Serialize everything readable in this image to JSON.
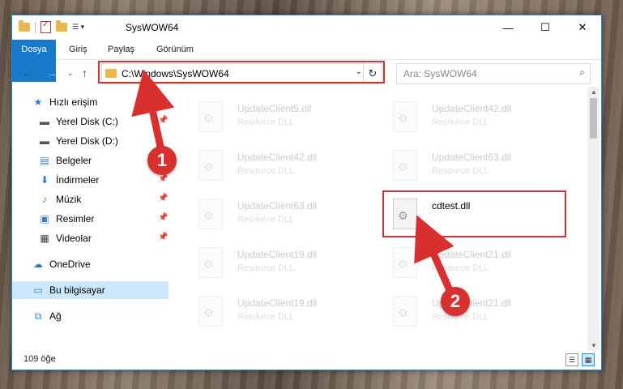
{
  "window": {
    "title": "SysWOW64",
    "controls": {
      "minimize": "—",
      "maximize": "☐",
      "close": "✕"
    }
  },
  "ribbon": {
    "tabs": [
      "Dosya",
      "Giriş",
      "Paylaş",
      "Görünüm"
    ]
  },
  "address": {
    "path": "C:\\Windows\\SysWOW64",
    "refresh_icon": "refresh-icon"
  },
  "search": {
    "placeholder": "Ara: SysWOW64"
  },
  "sidebar": {
    "items": [
      {
        "label": "Hızlı erişim",
        "icon": "star-icon"
      },
      {
        "label": "Yerel Disk (C:)",
        "icon": "drive-icon"
      },
      {
        "label": "Yerel Disk (D:)",
        "icon": "drive-icon"
      },
      {
        "label": "Belgeler",
        "icon": "documents-icon"
      },
      {
        "label": "İndirmeler",
        "icon": "download-icon"
      },
      {
        "label": "Müzik",
        "icon": "music-icon"
      },
      {
        "label": "Resimler",
        "icon": "pictures-icon"
      },
      {
        "label": "Videolar",
        "icon": "videos-icon"
      },
      {
        "label": "OneDrive",
        "icon": "cloud-icon"
      },
      {
        "label": "Bu bilgisayar",
        "icon": "computer-icon"
      },
      {
        "label": "Ağ",
        "icon": "network-icon"
      }
    ]
  },
  "files": [
    {
      "name": "UpdateClient5.dll",
      "type": "Resource DLL"
    },
    {
      "name": "UpdateClient42.dll",
      "type": "Resource DLL"
    },
    {
      "name": "UpdateClient42.dll",
      "type": "Resource DLL"
    },
    {
      "name": "UpdateClient63.dll",
      "type": "Resource DLL"
    },
    {
      "name": "UpdateClient63.dll",
      "type": "Resource DLL"
    },
    {
      "name": "cdtest.dll",
      "type": ""
    },
    {
      "name": "UpdateClient19.dll",
      "type": "Resource DLL"
    },
    {
      "name": "UpdateClient21.dll",
      "type": "Resource DLL"
    },
    {
      "name": "UpdateClient19.dll",
      "type": "Resource DLL"
    },
    {
      "name": "UpdateClient21.dll",
      "type": "Resource DLL"
    }
  ],
  "status": {
    "count": "109 öğe"
  },
  "annotations": {
    "step1": "1",
    "step2": "2"
  },
  "colors": {
    "accent": "#1979ca",
    "highlight": "#d9302f",
    "selected": "#cce8ff"
  }
}
